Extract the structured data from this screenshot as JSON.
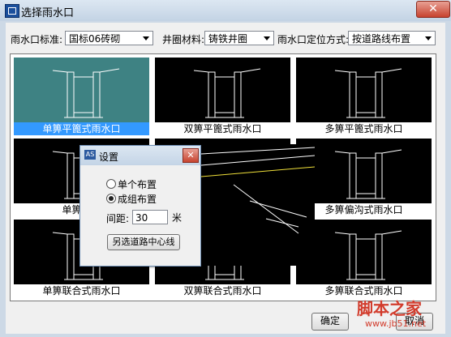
{
  "window": {
    "title": "选择雨水口",
    "close_symbol": "✕"
  },
  "filters": {
    "standard_label": "雨水口标准:",
    "standard_value": "国标06砖砌",
    "material_label": "井圈材料:",
    "material_value": "铸铁井圈",
    "position_label": "雨水口定位方式:",
    "position_value": "按道路线布置"
  },
  "grid": {
    "items": [
      {
        "label": "单箅平篦式雨水口",
        "selected": true
      },
      {
        "label": "双箅平篦式雨水口",
        "selected": false
      },
      {
        "label": "多箅平篦式雨水口",
        "selected": false
      },
      {
        "label": "单箅偏沟",
        "selected": false
      },
      {
        "label": "",
        "selected": false
      },
      {
        "label": "多箅偏沟式雨水口",
        "selected": false
      },
      {
        "label": "单箅联合式雨水口",
        "selected": false
      },
      {
        "label": "双箅联合式雨水口",
        "selected": false
      },
      {
        "label": "多箅联合式雨水口",
        "selected": false
      }
    ]
  },
  "dialog": {
    "title": "设置",
    "icon_text": "AS",
    "close_symbol": "✕",
    "option_single": "单个布置",
    "option_group": "成组布置",
    "selected_option": "成组布置",
    "spacing_label": "间距:",
    "spacing_value": "30",
    "spacing_unit": "米",
    "select_line_button": "另选道路中心线"
  },
  "buttons": {
    "ok": "确定",
    "cancel": "取消"
  },
  "watermark": {
    "text": "脚本之家",
    "url": "www.jb51.net"
  },
  "colors": {
    "selected_cell": "#3e8283",
    "selected_caption": "#3399ff",
    "cell_bg": "#000000"
  }
}
